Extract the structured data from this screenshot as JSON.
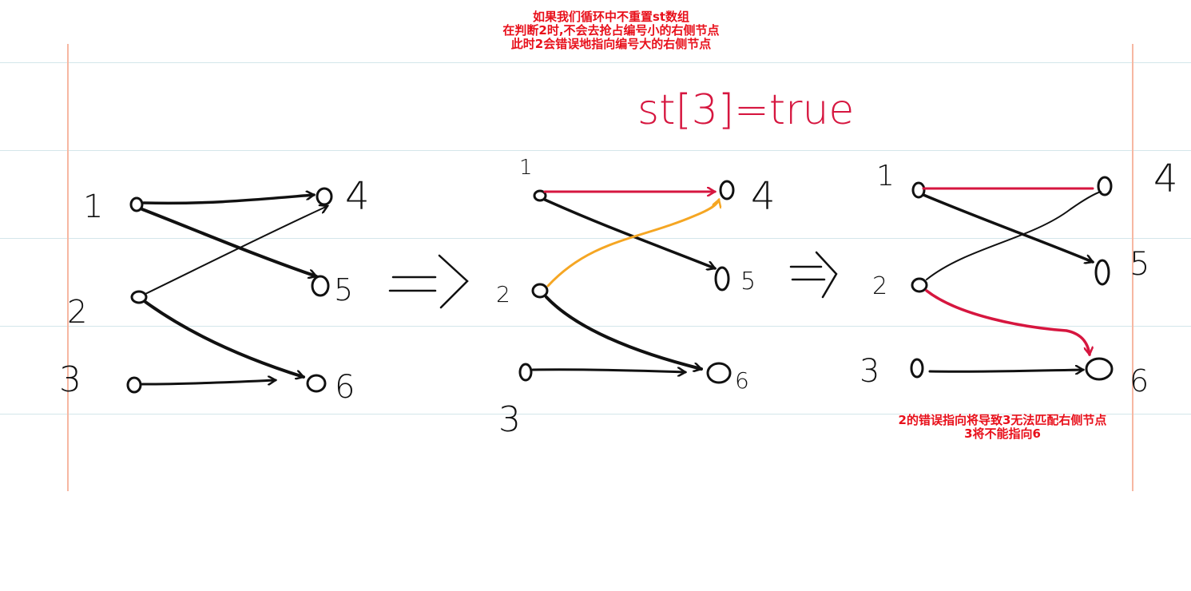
{
  "notes": {
    "top": [
      "如果我们循环中不重置st数组",
      "在判断2时,不会去抢占编号小的右侧节点",
      "此时2会错误地指向编号大的右侧节点"
    ],
    "bottom": [
      "2的错误指向将导致3无法匹配右侧节点",
      "3将不能指向6"
    ]
  },
  "annotation": "st[3]=true",
  "colors": {
    "ink": "#111111",
    "red": "#d6163f",
    "orange": "#f5a623",
    "note_red": "#e8101b",
    "margin": "#f7b7a2",
    "rule": "#d4e6ea"
  },
  "stages": [
    {
      "left_labels": [
        "1",
        "2",
        "3"
      ],
      "right_labels": [
        "4",
        "5",
        "6"
      ],
      "edges": [
        {
          "from": "1",
          "to": "4",
          "color": "ink"
        },
        {
          "from": "1",
          "to": "5",
          "color": "ink"
        },
        {
          "from": "2",
          "to": "4",
          "color": "ink"
        },
        {
          "from": "2",
          "to": "6",
          "color": "ink"
        },
        {
          "from": "3",
          "to": "6",
          "color": "ink"
        }
      ]
    },
    {
      "left_labels": [
        "1",
        "2",
        "3"
      ],
      "right_labels": [
        "4",
        "5",
        "6"
      ],
      "edges": [
        {
          "from": "1",
          "to": "4",
          "color": "red"
        },
        {
          "from": "1",
          "to": "5",
          "color": "ink"
        },
        {
          "from": "2",
          "to": "4",
          "color": "orange"
        },
        {
          "from": "2",
          "to": "6",
          "color": "ink"
        },
        {
          "from": "3",
          "to": "6",
          "color": "ink"
        }
      ]
    },
    {
      "left_labels": [
        "1",
        "2",
        "3"
      ],
      "right_labels": [
        "4",
        "5",
        "6"
      ],
      "edges": [
        {
          "from": "1",
          "to": "4",
          "color": "red"
        },
        {
          "from": "1",
          "to": "5",
          "color": "ink"
        },
        {
          "from": "2",
          "to": "4",
          "color": "ink"
        },
        {
          "from": "2",
          "to": "6",
          "color": "red"
        },
        {
          "from": "3",
          "to": "6",
          "color": "ink"
        }
      ]
    }
  ],
  "transition_arrows": [
    "=>",
    "=>"
  ]
}
